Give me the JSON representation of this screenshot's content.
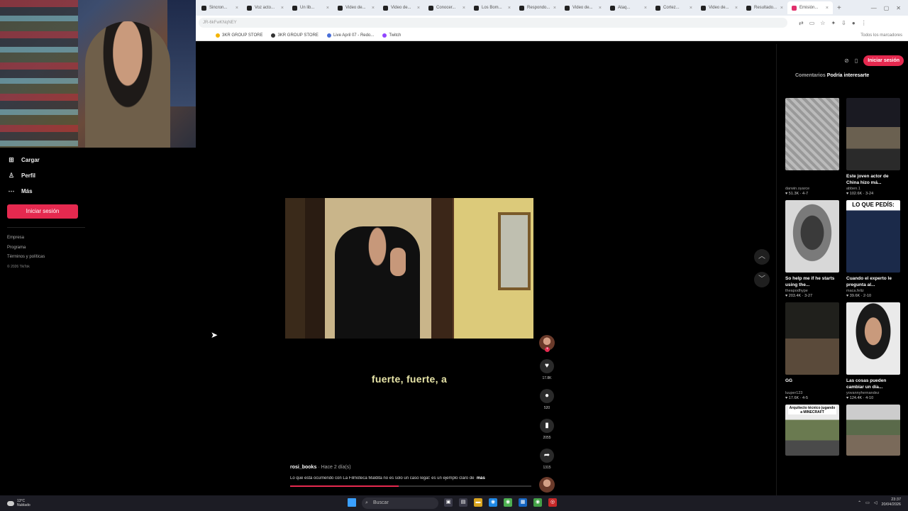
{
  "browser": {
    "tabs": [
      {
        "label": "Sincron..."
      },
      {
        "label": "Voz acto..."
      },
      {
        "label": "Un lib..."
      },
      {
        "label": "Video de..."
      },
      {
        "label": "Video de..."
      },
      {
        "label": "Conocer..."
      },
      {
        "label": "Los Bom..."
      },
      {
        "label": "Respondo..."
      },
      {
        "label": "Video de..."
      },
      {
        "label": "Ataq..."
      },
      {
        "label": "Cortez..."
      },
      {
        "label": "Video de..."
      },
      {
        "label": "Resultado..."
      },
      {
        "label": "Emisión..."
      }
    ],
    "new_tab": "+",
    "url": "JR-6kFwKNqNEY",
    "bookmarks": [
      {
        "label": "3KR GROUP STORE"
      },
      {
        "label": "3KR GROUP STORE"
      },
      {
        "label": "Live April 07 - Redo..."
      },
      {
        "label": "Twitch"
      }
    ],
    "all_bookmarks": "Todos los marcadores"
  },
  "sidebar": {
    "items": [
      {
        "label": "Cargar",
        "icon": "upload-icon"
      },
      {
        "label": "Perfil",
        "icon": "person-icon"
      },
      {
        "label": "Más",
        "icon": "more-icon"
      }
    ],
    "login_label": "Iniciar sesión",
    "footer": [
      "Empresa",
      "Programa",
      "Términos y políticas"
    ],
    "copyright": "© 2026 TikTok"
  },
  "video": {
    "caption": "fuerte, fuerte, a",
    "author": "rosi_books",
    "time_ago": " · Hace 2 día(s)",
    "description": "Lo que está ocurriendo con La Filmoteca Maldita no es solo un caso legal: es un ejemplo claro de",
    "more": "más",
    "progress": 0.45
  },
  "actions": {
    "likes": "17.8K",
    "comments": "520",
    "saves": "2055",
    "shares": "1315"
  },
  "right_panel": {
    "login_label": "Iniciar sesión",
    "tabs": [
      {
        "label": "Comentarios",
        "active": false
      },
      {
        "label": "Podría interesarte",
        "active": true
      }
    ],
    "cards": [
      {
        "title": "",
        "author": "darwin.oyarce",
        "stats": "♥ 51.3K · 4-7"
      },
      {
        "title": "Este joven actor de China hizo má...",
        "author": "abben.1",
        "stats": "♥ 102.6K · 3-24"
      },
      {
        "title": "So help me if he starts using the...",
        "author": "theapodhype",
        "stats": "♥ 203.4K · 3-27"
      },
      {
        "title": "Cuando el experto le pregunta al...",
        "author": "maca.feliz",
        "stats": "♥ 39.6K · 2-10",
        "overlay": "LO QUE PEDÍS:"
      },
      {
        "title": "GG",
        "author": "luuper123",
        "stats": "♥ 17.6K · 4-5"
      },
      {
        "title": "Las cosas pueden cambiar un día...",
        "author": "yovannyhernandez",
        "stats": "♥ 124.4K · 4-10"
      },
      {
        "title": "",
        "author": "",
        "stats": "",
        "overlay": "Arquitecto técnico jugando a MINECRAFT"
      },
      {
        "title": "",
        "author": "",
        "stats": ""
      }
    ]
  },
  "taskbar": {
    "weather_temp": "13°C",
    "weather_desc": "Nublado",
    "search": "Buscar",
    "time": "23:37",
    "date": "20/04/2026"
  }
}
